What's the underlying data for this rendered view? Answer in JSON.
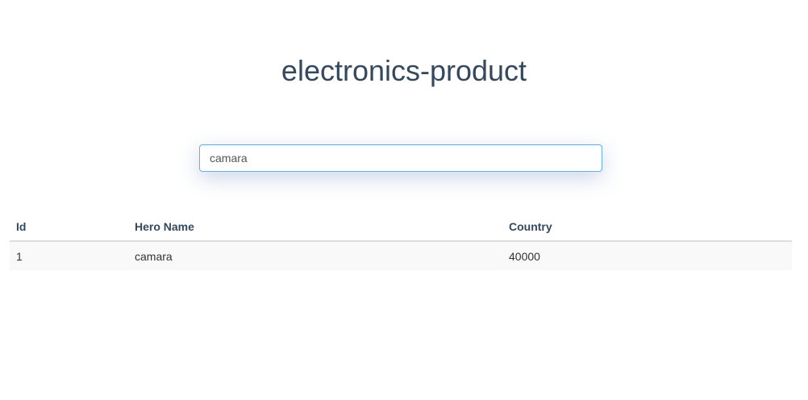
{
  "header": {
    "title": "electronics-product"
  },
  "search": {
    "value": "camara",
    "placeholder": ""
  },
  "table": {
    "columns": [
      "Id",
      "Hero Name",
      "Country"
    ],
    "rows": [
      {
        "id": "1",
        "name": "camara",
        "country": "40000"
      }
    ]
  }
}
